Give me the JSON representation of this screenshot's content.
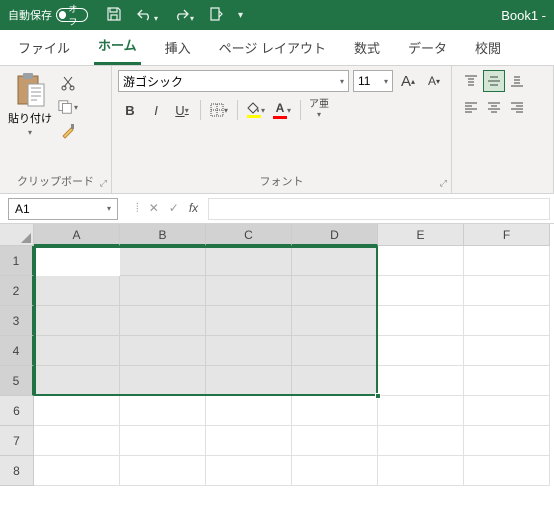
{
  "titlebar": {
    "autosave_label": "自動保存",
    "autosave_state": "オフ",
    "doc_title": "Book1 -"
  },
  "tabs": {
    "file": "ファイル",
    "home": "ホーム",
    "insert": "挿入",
    "page_layout": "ページ レイアウト",
    "formulas": "数式",
    "data": "データ",
    "review": "校閲"
  },
  "ribbon": {
    "clipboard": {
      "paste": "貼り付け",
      "group_label": "クリップボード"
    },
    "font": {
      "name": "游ゴシック",
      "size": "11",
      "increase": "A",
      "decrease": "A",
      "bold": "B",
      "italic": "I",
      "underline": "U",
      "phonetic": "ア亜",
      "group_label": "フォント",
      "fill_color": "#ffff00",
      "font_color": "#ff0000"
    }
  },
  "formula_bar": {
    "name_box": "A1",
    "fx": "fx"
  },
  "grid": {
    "columns": [
      "A",
      "B",
      "C",
      "D",
      "E",
      "F"
    ],
    "rows": [
      "1",
      "2",
      "3",
      "4",
      "5",
      "6",
      "7",
      "8"
    ],
    "selected_cols": [
      "A",
      "B",
      "C",
      "D"
    ],
    "selected_rows": [
      "1",
      "2",
      "3",
      "4",
      "5"
    ],
    "active_cell": "A1"
  }
}
